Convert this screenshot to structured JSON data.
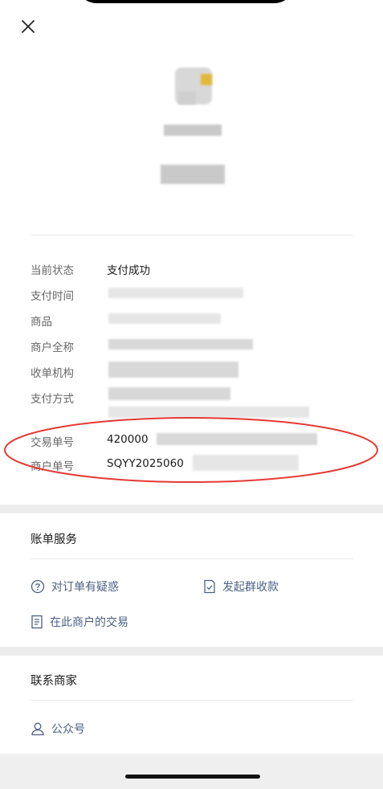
{
  "header": {
    "close_icon": "close-icon"
  },
  "details": {
    "status": {
      "label": "当前状态",
      "value": "支付成功"
    },
    "pay_time": {
      "label": "支付时间"
    },
    "goods": {
      "label": "商品"
    },
    "merchant_name": {
      "label": "商户全称"
    },
    "acquirer": {
      "label": "收单机构"
    },
    "pay_method": {
      "label": "支付方式"
    },
    "transaction_no": {
      "label": "交易单号",
      "value": "420000"
    },
    "merchant_order_no": {
      "label": "商户单号",
      "value": "SQYY2025060"
    }
  },
  "bill_service": {
    "title": "账单服务",
    "question": {
      "label": "对订单有疑惑",
      "icon": "question-circle-icon"
    },
    "group_collect": {
      "label": "发起群收款",
      "icon": "document-check-icon"
    },
    "merchant_trades": {
      "label": "在此商户的交易",
      "icon": "list-document-icon"
    }
  },
  "contact": {
    "title": "联系商家",
    "official_account": {
      "label": "公众号",
      "icon": "person-icon"
    }
  },
  "colors": {
    "annotation": "#e53935",
    "link": "#4b5f82"
  }
}
